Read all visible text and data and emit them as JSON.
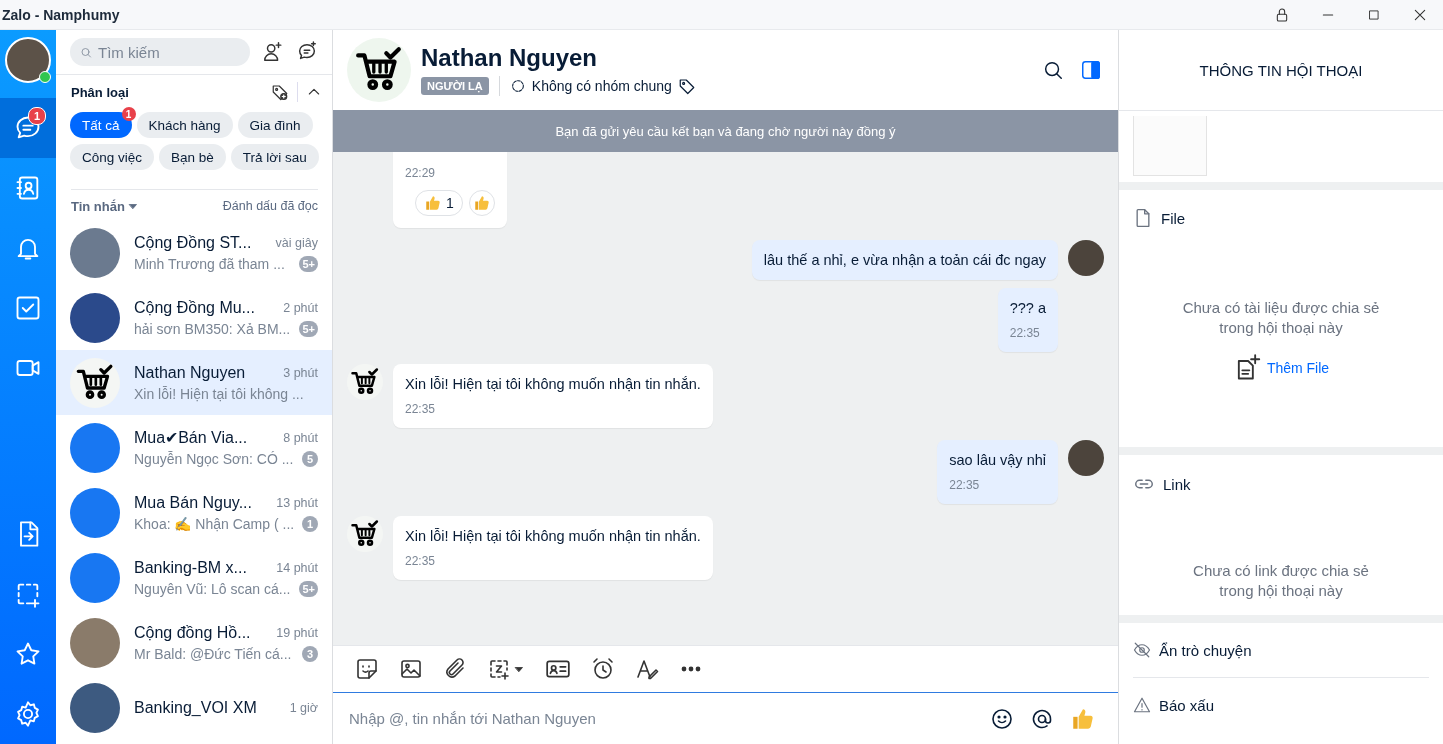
{
  "window": {
    "title": "Zalo - Namphumy"
  },
  "nav": {
    "profile": {
      "online": true
    },
    "top_items": [
      {
        "kind": "chat",
        "selected": true,
        "badge": "1"
      },
      {
        "kind": "contacts",
        "selected": false
      },
      {
        "kind": "bell",
        "selected": false
      },
      {
        "kind": "todo",
        "selected": false
      },
      {
        "kind": "video",
        "selected": false
      }
    ],
    "bottom_items": [
      {
        "kind": "filein",
        "selected": false
      },
      {
        "kind": "capture",
        "selected": false
      },
      {
        "kind": "star",
        "selected": false
      },
      {
        "kind": "gear",
        "selected": false
      }
    ]
  },
  "sidebar": {
    "search": {
      "placeholder": "Tìm kiếm"
    },
    "category": {
      "title": "Phân loại",
      "chips": [
        {
          "label": "Tất cả",
          "selected": true,
          "badge": "1"
        },
        {
          "label": "Khách hàng",
          "selected": false
        },
        {
          "label": "Gia đình",
          "selected": false
        },
        {
          "label": "Công việc",
          "selected": false
        },
        {
          "label": "Bạn bè",
          "selected": false
        },
        {
          "label": "Trả lời sau",
          "selected": false
        }
      ]
    },
    "list_header": {
      "title": "Tin nhắn",
      "action": "Đánh dấu đã đọc"
    },
    "conversations": [
      {
        "name": "Cộng Đồng ST...",
        "time": "vài giây",
        "preview": "Minh Trương đã tham ...",
        "unread": "5+",
        "kind": "photo",
        "selected": false
      },
      {
        "name": "Cộng Đồng Mu...",
        "time": "2 phút",
        "preview": "hải sơn BM350: Xả BM...",
        "unread": "5+",
        "kind": "photo",
        "selected": false
      },
      {
        "name": "Nathan Nguyen",
        "time": "3 phút",
        "preview": "Xin lỗi! Hiện tại tôi không ...",
        "kind": "cart",
        "selected": true
      },
      {
        "name": "Mua✔Bán Via...",
        "time": "8 phút",
        "preview": "Nguyễn Ngọc Sơn: CÓ ...",
        "unread": "5",
        "kind": "photo",
        "selected": false
      },
      {
        "name": "Mua Bán Nguy...",
        "time": "13 phút",
        "preview": "Khoa: ✍ Nhận Camp ( ...",
        "unread": "1",
        "kind": "logo",
        "selected": false
      },
      {
        "name": "Banking-BM x...",
        "time": "14 phút",
        "preview": "Nguyên Vũ: Lô scan cá...",
        "unread": "5+",
        "kind": "logo",
        "selected": false
      },
      {
        "name": "Cộng đồng Hồ...",
        "time": "19 phút",
        "preview": "Mr Bald: @Đức Tiến cá...",
        "unread": "3",
        "kind": "photo",
        "selected": false
      },
      {
        "name": "Banking_VOI XM",
        "time": "1 giờ",
        "kind": "photo",
        "selected": false
      }
    ]
  },
  "chat": {
    "header": {
      "name": "Nathan Nguyen",
      "tag": "NGƯỜI LẠ",
      "groups": "Không có nhóm chung"
    },
    "banner": "Bạn đã gửi yêu cầu kết bạn và đang chờ người này đồng ý",
    "messages": [
      {
        "kind": "incoming",
        "time": "22:29",
        "reaction_count": "1",
        "show_avatar": false
      },
      {
        "kind": "outgoing",
        "text": "lâu thế a nhỉ, e vừa nhận a toản cái đc ngay",
        "show_avatar": true
      },
      {
        "kind": "outgoing",
        "text": "??? a",
        "time": "22:35",
        "show_avatar": false
      },
      {
        "kind": "incoming",
        "text": "Xin lỗi! Hiện tại tôi không muốn nhận tin nhắn.",
        "time": "22:35",
        "show_avatar": true
      },
      {
        "kind": "outgoing",
        "text": "sao lâu vậy nhỉ",
        "time": "22:35",
        "show_avatar": true
      },
      {
        "kind": "incoming",
        "text": "Xin lỗi! Hiện tại tôi không muốn nhận tin nhắn.",
        "time": "22:35",
        "show_avatar": true
      }
    ],
    "composer": {
      "placeholder": "Nhập @, tin nhắn tới Nathan Nguyen"
    }
  },
  "info_panel": {
    "title": "THÔNG TIN HỘI THOẠI",
    "file_section": {
      "title": "File",
      "empty": "Chưa có tài liệu được chia sẻ trong hội thoại này",
      "action": "Thêm File"
    },
    "link_section": {
      "title": "Link",
      "empty": "Chưa có link được chia sẻ trong hội thoại này"
    },
    "actions": [
      {
        "kind": "hide",
        "label": "Ẩn trò chuyện"
      },
      {
        "kind": "report",
        "label": "Báo xấu"
      }
    ]
  }
}
